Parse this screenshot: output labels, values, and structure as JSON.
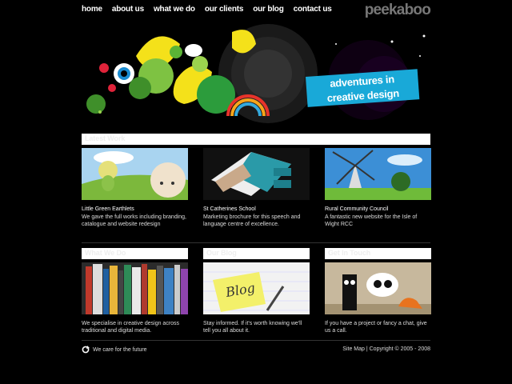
{
  "nav": {
    "items": [
      "home",
      "about us",
      "what we do",
      "our clients",
      "our blog",
      "contact us"
    ]
  },
  "logo": "peekaboo",
  "hero": {
    "banner_line1": "adventures in",
    "banner_line2": "creative design"
  },
  "latest": {
    "heading": "Latest Work",
    "items": [
      {
        "title": "Little Green Earthlets",
        "desc": "We gave the full works including branding, catalogue and website redesign"
      },
      {
        "title": "St Catherines School",
        "desc": "Marketing brochure for this speech and language centre of excellence."
      },
      {
        "title": "Rural Community Council",
        "desc": "A fantastic new website for the Isle of Wight RCC"
      }
    ]
  },
  "features": {
    "items": [
      {
        "heading": "What We Do",
        "desc": "We specialise in creative design across traditional and digital media."
      },
      {
        "heading": "Our Blog",
        "blog_label": "Blog",
        "desc": "Stay informed. If it's worth knowing we'll tell you all about it."
      },
      {
        "heading": "Get In Touch",
        "desc": "If you have a project or fancy a chat, give us a call."
      }
    ]
  },
  "footer": {
    "tagline": "We care for the future",
    "sitemap": "Site Map",
    "copyright": "| Copyright © 2005 - 2008"
  },
  "colors": {
    "background": "#000000",
    "banner": "#19a9d8",
    "logo": "#777777"
  }
}
